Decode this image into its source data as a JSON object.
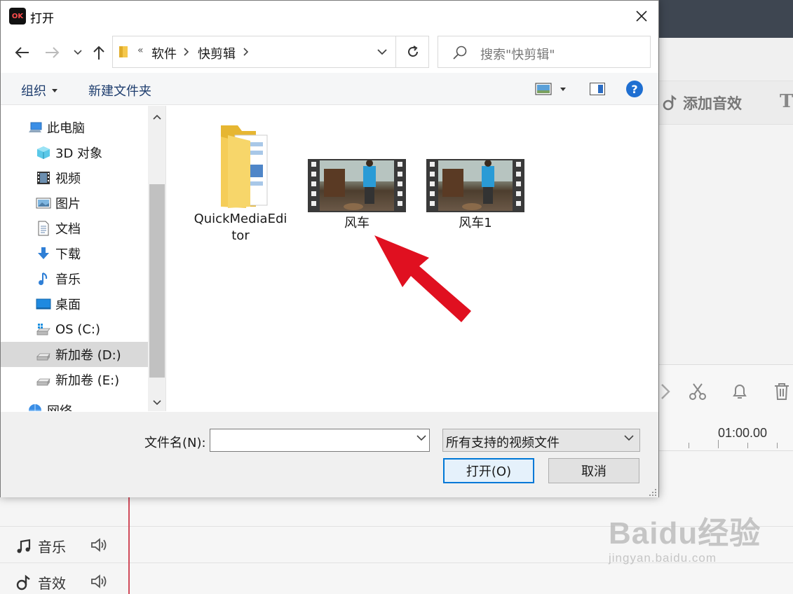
{
  "dialog": {
    "title": "打开",
    "app_logo_text": "OK"
  },
  "address": {
    "overflow": "«",
    "segments": [
      "软件",
      "快剪辑"
    ]
  },
  "search": {
    "placeholder": "搜索\"快剪辑\""
  },
  "commands": {
    "organize": "组织",
    "new_folder": "新建文件夹",
    "help": "?"
  },
  "nav_pane": {
    "items": [
      {
        "label": "此电脑",
        "icon": "computer-icon"
      },
      {
        "label": "3D 对象",
        "icon": "3d-objects-icon"
      },
      {
        "label": "视频",
        "icon": "videos-icon"
      },
      {
        "label": "图片",
        "icon": "pictures-icon"
      },
      {
        "label": "文档",
        "icon": "documents-icon"
      },
      {
        "label": "下载",
        "icon": "downloads-icon"
      },
      {
        "label": "音乐",
        "icon": "music-icon"
      },
      {
        "label": "桌面",
        "icon": "desktop-icon"
      },
      {
        "label": "OS (C:)",
        "icon": "os-drive-icon"
      },
      {
        "label": "新加卷 (D:)",
        "icon": "drive-icon",
        "selected": true
      },
      {
        "label": "新加卷 (E:)",
        "icon": "drive-icon"
      },
      {
        "label": "网络",
        "icon": "network-icon"
      }
    ]
  },
  "files": [
    {
      "name": "QuickMediaEditor",
      "name_wrap": "tor",
      "name_first": "QuickMediaEdi",
      "type": "folder"
    },
    {
      "name": "风车",
      "type": "video"
    },
    {
      "name": "风车1",
      "type": "video"
    }
  ],
  "bottom": {
    "filename_label": "文件名(N):",
    "filename_value": "",
    "filter_value": "所有支持的视频文件",
    "open_button": "打开(O)",
    "cancel_button": "取消"
  },
  "background_app": {
    "add_sound_label": "添加音效",
    "text_tool": "T",
    "time_marker": "01:00.00",
    "tracks": [
      {
        "label": "音乐",
        "icon": "music-note-icon"
      },
      {
        "label": "音效",
        "icon": "sound-effect-icon"
      }
    ],
    "watermark_main": "Baidu经验",
    "watermark_sub": "jingyan.baidu.com"
  },
  "colors": {
    "accent": "#0078d7",
    "arrow": "#e01020",
    "topbar": "#3e4651"
  }
}
